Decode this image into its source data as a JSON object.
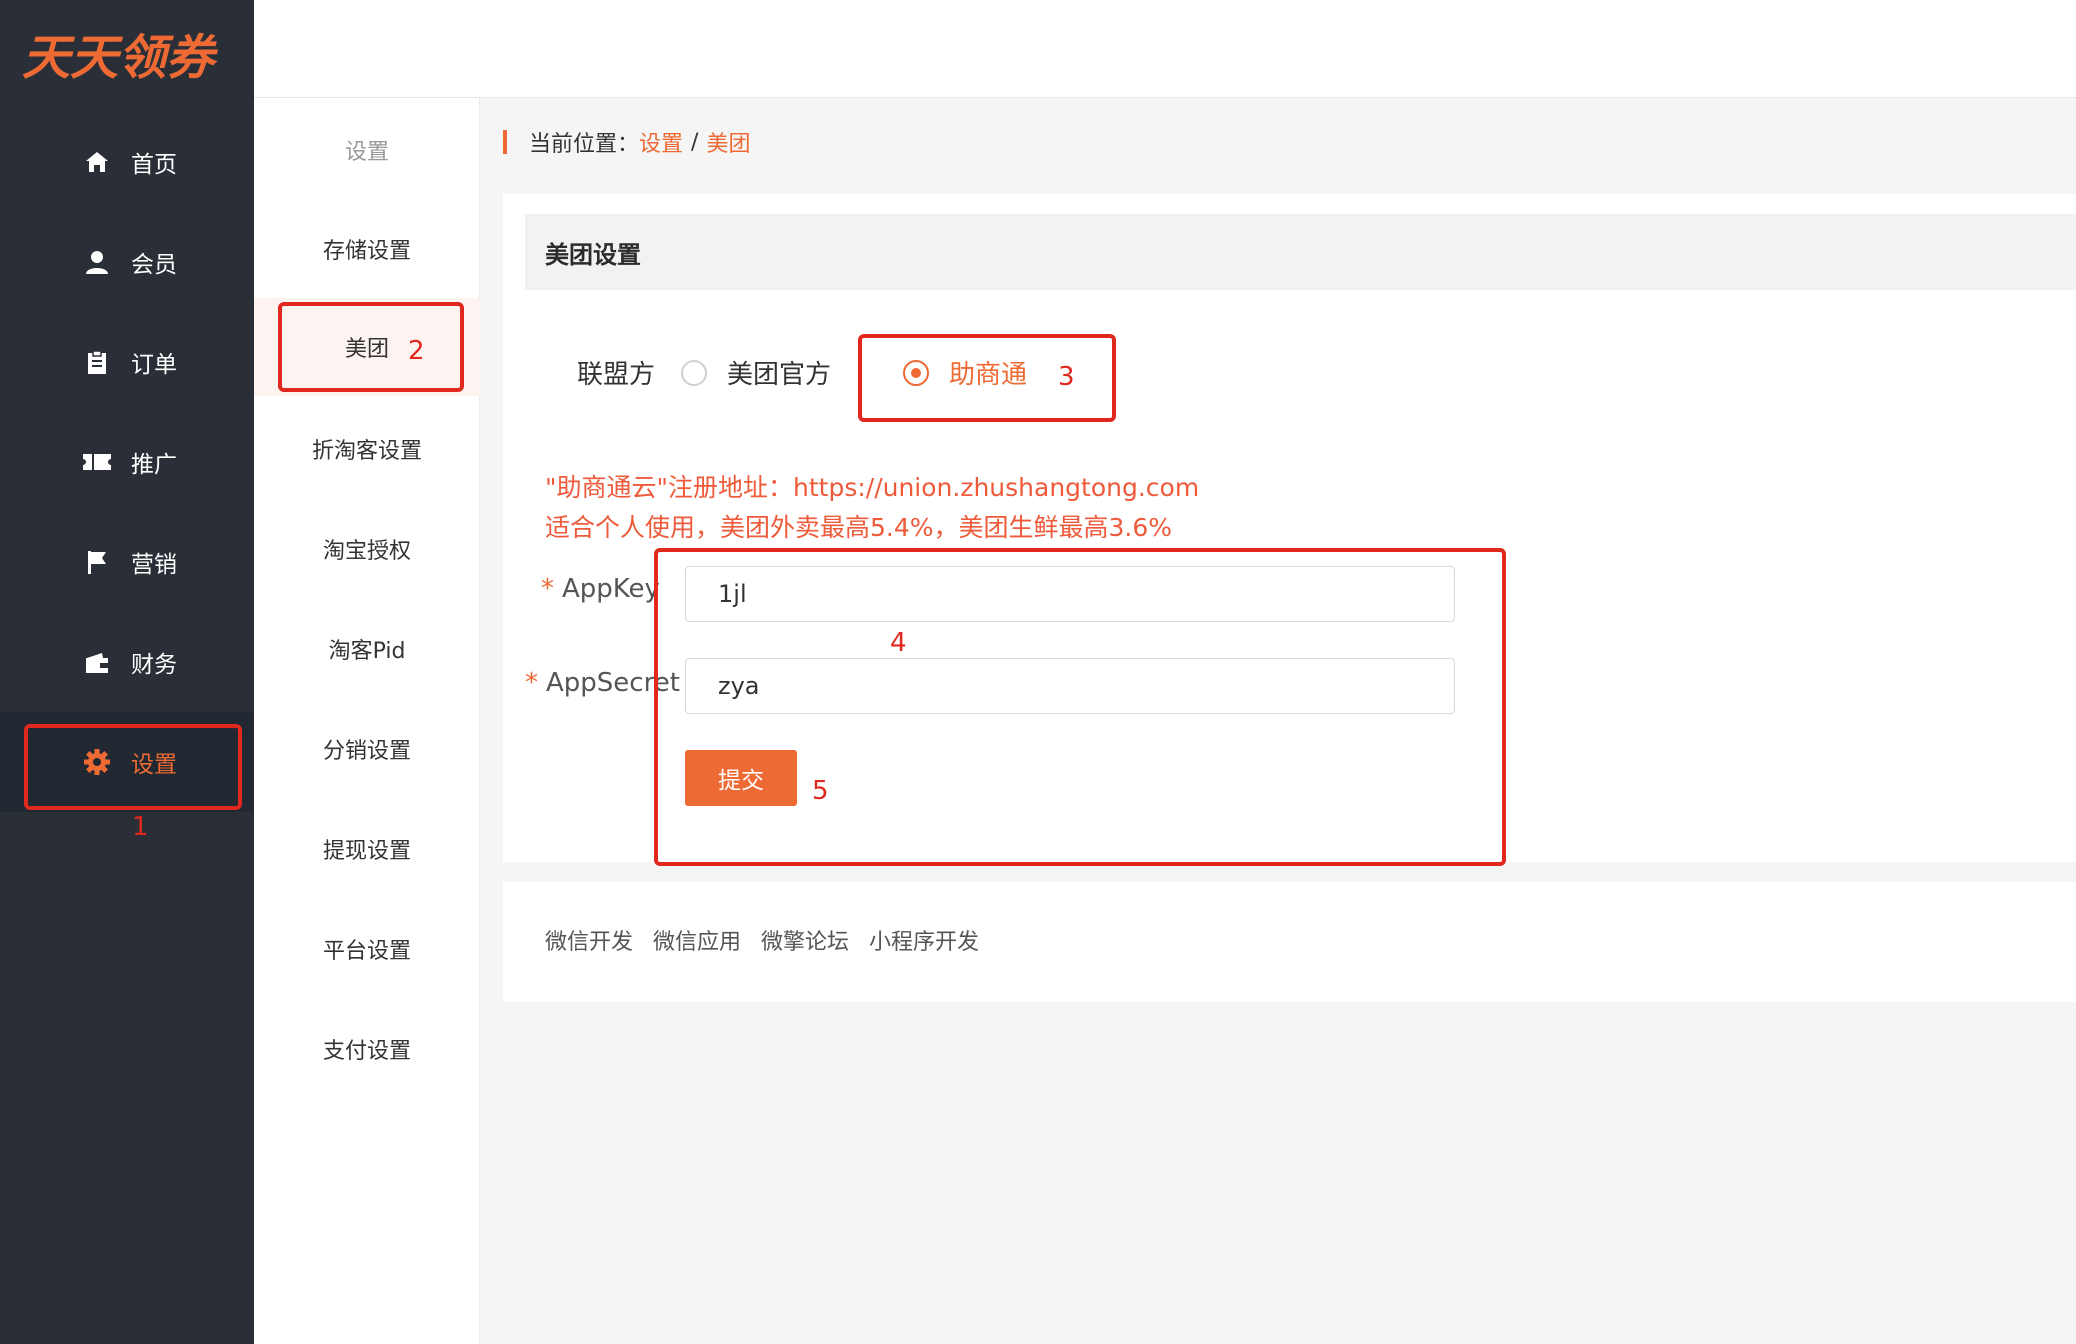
{
  "app": {
    "logo": "天天领券"
  },
  "sidebar": {
    "items": [
      {
        "label": "首页",
        "icon": "home-icon"
      },
      {
        "label": "会员",
        "icon": "user-icon"
      },
      {
        "label": "订单",
        "icon": "clipboard-icon"
      },
      {
        "label": "推广",
        "icon": "ticket-icon"
      },
      {
        "label": "营销",
        "icon": "flag-icon"
      },
      {
        "label": "财务",
        "icon": "wallet-icon"
      },
      {
        "label": "设置",
        "icon": "gear-icon",
        "active": true
      }
    ]
  },
  "subnav": {
    "title": "设置",
    "items": [
      {
        "label": "存储设置"
      },
      {
        "label": "美团",
        "active": true
      },
      {
        "label": "折淘客设置"
      },
      {
        "label": "淘宝授权"
      },
      {
        "label": "淘客Pid"
      },
      {
        "label": "分销设置"
      },
      {
        "label": "提现设置"
      },
      {
        "label": "平台设置"
      },
      {
        "label": "支付设置"
      }
    ]
  },
  "breadcrumb": {
    "prefix": "当前位置：",
    "crumbs": [
      "设置",
      "美团"
    ],
    "separator": "/"
  },
  "panel": {
    "title": "美团设置",
    "radio_group_label": "联盟方",
    "options": [
      {
        "label": "美团官方",
        "checked": false
      },
      {
        "label": "助商通",
        "checked": true
      }
    ],
    "note_line1": "\"助商通云\"注册地址：https://union.zhushangtong.com",
    "note_line2": "适合个人使用，美团外卖最高5.4%，美团生鲜最高3.6%",
    "fields": {
      "appkey": {
        "label": "AppKey",
        "value": "1jl"
      },
      "appsecret": {
        "label": "AppSecret",
        "value": "zya"
      }
    },
    "submit_label": "提交"
  },
  "footer": {
    "links": [
      "微信开发",
      "微信应用",
      "微擎论坛",
      "小程序开发"
    ]
  },
  "annotations": [
    "1",
    "2",
    "3",
    "4",
    "5"
  ],
  "colors": {
    "accent": "#ee6a35",
    "sidebar_bg": "#2a2f37",
    "annotation": "#e0281e"
  }
}
